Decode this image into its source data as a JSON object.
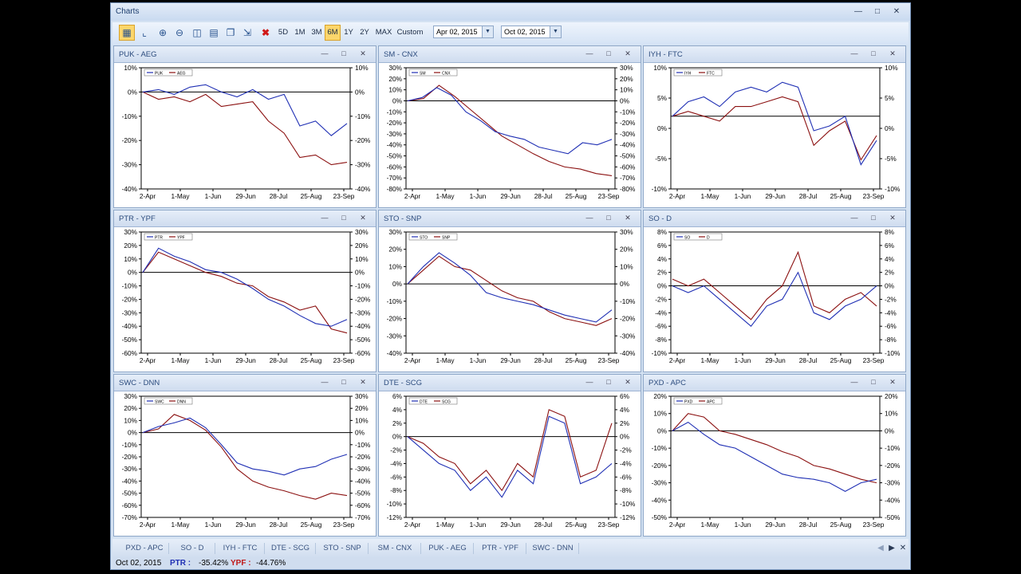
{
  "window": {
    "title": "Charts"
  },
  "toolbar": {
    "ranges": [
      "5D",
      "1M",
      "3M",
      "6M",
      "1Y",
      "2Y",
      "MAX",
      "Custom"
    ],
    "selected_range": "6M",
    "start_date": "Apr 02, 2015",
    "end_date": "Oct 02, 2015"
  },
  "x_tick_labels": [
    "2-Apr",
    "1-May",
    "1-Jun",
    "29-Jun",
    "28-Jul",
    "25-Aug",
    "23-Sep"
  ],
  "colors": {
    "series_a": "#1f2fb4",
    "series_b": "#8b1010",
    "selected_tab": "#fcd66b"
  },
  "panels": [
    {
      "title": "PUK - AEG",
      "legend": [
        "PUK",
        "AEG"
      ],
      "y_ticks": [
        "10%",
        "0%",
        "-10%",
        "-20%",
        "-30%",
        "-40%"
      ],
      "ylim": [
        -40,
        10
      ],
      "a": [
        0,
        1,
        -1,
        2,
        3,
        0,
        -2,
        1,
        -3,
        -1,
        -14,
        -12,
        -18,
        -13
      ],
      "b": [
        0,
        -3,
        -2,
        -4,
        -1,
        -6,
        -5,
        -4,
        -12,
        -17,
        -27,
        -26,
        -30,
        -29
      ]
    },
    {
      "title": "SM - CNX",
      "legend": [
        "SM",
        "CNX"
      ],
      "y_ticks": [
        "30%",
        "20%",
        "10%",
        "0%",
        "-10%",
        "-20%",
        "-30%",
        "-40%",
        "-50%",
        "-60%",
        "-70%",
        "-80%"
      ],
      "ylim": [
        -80,
        30
      ],
      "a": [
        0,
        3,
        12,
        5,
        -10,
        -18,
        -28,
        -32,
        -35,
        -42,
        -45,
        -48,
        -38,
        -40,
        -35
      ],
      "b": [
        0,
        2,
        14,
        4,
        -8,
        -20,
        -32,
        -40,
        -48,
        -55,
        -60,
        -62,
        -66,
        -68
      ],
      "ref": 0
    },
    {
      "title": "IYH - FTC",
      "legend": [
        "IYH",
        "FTC"
      ],
      "y_ticks": [
        "10%",
        "5%",
        "0%",
        "-5%",
        "-10%"
      ],
      "ylim": [
        -15,
        10
      ],
      "a": [
        0,
        3,
        4,
        2,
        5,
        6,
        5,
        7,
        6,
        -3,
        -2,
        0,
        -10,
        -5
      ],
      "b": [
        0,
        1,
        0,
        -1,
        2,
        2,
        3,
        4,
        3,
        -6,
        -3,
        -1,
        -9,
        -4
      ]
    },
    {
      "title": "PTR - YPF",
      "legend": [
        "PTR",
        "YPF"
      ],
      "y_ticks": [
        "30%",
        "20%",
        "10%",
        "0%",
        "-10%",
        "-20%",
        "-30%",
        "-40%",
        "-50%",
        "-60%"
      ],
      "ylim": [
        -60,
        30
      ],
      "a": [
        0,
        18,
        12,
        8,
        2,
        0,
        -5,
        -12,
        -20,
        -25,
        -32,
        -38,
        -40,
        -35
      ],
      "b": [
        0,
        15,
        10,
        5,
        0,
        -3,
        -8,
        -10,
        -18,
        -22,
        -28,
        -25,
        -42,
        -45
      ]
    },
    {
      "title": "STO - SNP",
      "legend": [
        "STO",
        "SNP"
      ],
      "y_ticks": [
        "30%",
        "20%",
        "10%",
        "0%",
        "-10%",
        "-20%",
        "-30%",
        "-40%"
      ],
      "ylim": [
        -40,
        30
      ],
      "a": [
        0,
        10,
        18,
        12,
        5,
        -5,
        -8,
        -10,
        -12,
        -15,
        -18,
        -20,
        -22,
        -15
      ],
      "b": [
        0,
        8,
        16,
        10,
        8,
        2,
        -4,
        -8,
        -10,
        -16,
        -20,
        -22,
        -24,
        -20
      ]
    },
    {
      "title": "SO - D",
      "legend": [
        "SO",
        "D"
      ],
      "y_ticks": [
        "8%",
        "6%",
        "4%",
        "2%",
        "0%",
        "-2%",
        "-4%",
        "-6%",
        "-8%",
        "-10%"
      ],
      "ylim": [
        -10,
        8
      ],
      "a": [
        0,
        -1,
        0,
        -2,
        -4,
        -6,
        -3,
        -2,
        2,
        -4,
        -5,
        -3,
        -2,
        0
      ],
      "b": [
        1,
        0,
        1,
        -1,
        -3,
        -5,
        -2,
        0,
        5,
        -3,
        -4,
        -2,
        -1,
        -3
      ]
    },
    {
      "title": "SWC - DNN",
      "legend": [
        "SWC",
        "DNN"
      ],
      "y_ticks": [
        "30%",
        "20%",
        "10%",
        "0%",
        "-10%",
        "-20%",
        "-30%",
        "-40%",
        "-50%",
        "-60%",
        "-70%"
      ],
      "ylim": [
        -70,
        30
      ],
      "a": [
        0,
        5,
        8,
        12,
        4,
        -10,
        -25,
        -30,
        -32,
        -35,
        -30,
        -28,
        -22,
        -18
      ],
      "b": [
        0,
        3,
        15,
        10,
        2,
        -12,
        -30,
        -40,
        -45,
        -48,
        -52,
        -55,
        -50,
        -52
      ]
    },
    {
      "title": "DTE - SCG",
      "legend": [
        "DTE",
        "SCG"
      ],
      "y_ticks": [
        "6%",
        "4%",
        "2%",
        "0%",
        "-2%",
        "-4%",
        "-6%",
        "-8%",
        "-10%",
        "-12%"
      ],
      "ylim": [
        -12,
        6
      ],
      "a": [
        0,
        -2,
        -4,
        -5,
        -8,
        -6,
        -9,
        -5,
        -7,
        3,
        2,
        -7,
        -6,
        -4
      ],
      "b": [
        0,
        -1,
        -3,
        -4,
        -7,
        -5,
        -8,
        -4,
        -6,
        4,
        3,
        -6,
        -5,
        2
      ]
    },
    {
      "title": "PXD - APC",
      "legend": [
        "PXD",
        "APC"
      ],
      "y_ticks": [
        "20%",
        "10%",
        "0%",
        "-10%",
        "-20%",
        "-30%",
        "-40%",
        "-50%"
      ],
      "ylim": [
        -50,
        20
      ],
      "a": [
        0,
        5,
        -2,
        -8,
        -10,
        -15,
        -20,
        -25,
        -27,
        -28,
        -30,
        -35,
        -30,
        -28
      ],
      "b": [
        0,
        10,
        8,
        0,
        -2,
        -5,
        -8,
        -12,
        -15,
        -20,
        -22,
        -25,
        -28,
        -30
      ]
    }
  ],
  "tabs": [
    "PXD - APC",
    "SO - D",
    "IYH - FTC",
    "DTE - SCG",
    "STO - SNP",
    "SM - CNX",
    "PUK - AEG",
    "PTR - YPF",
    "SWC - DNN"
  ],
  "status": {
    "date": "Oct 02, 2015",
    "a_label": "PTR :",
    "a_value": "-35.42%",
    "b_label": "YPF :",
    "b_value": "-44.76%"
  }
}
